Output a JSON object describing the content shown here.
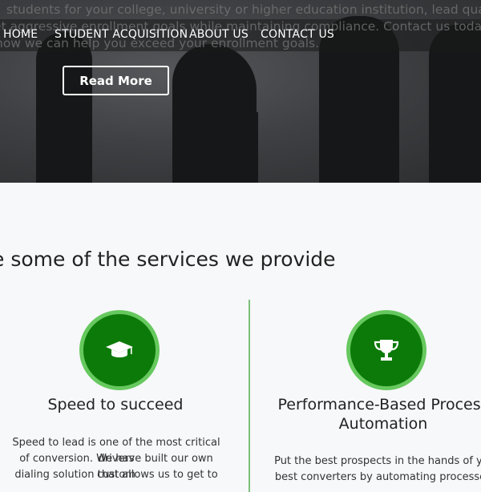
{
  "hero": {
    "text_lines": [
      "students for your college, university or higher education institution, lead quality",
      "et aggressive enrollment goals while maintaining compliance. Contact us today to",
      "how we can help you exceed your enrollment goals."
    ],
    "read_more_label": "Read More"
  },
  "nav": {
    "items": [
      {
        "label": "HOME"
      },
      {
        "label": "STUDENT ACQUISITION"
      },
      {
        "label": "ABOUT US"
      },
      {
        "label": "CONTACT US"
      }
    ]
  },
  "services": {
    "heading": "e some of the services we provide",
    "cards": [
      {
        "icon": "graduation-cap-icon",
        "title": "Speed to succeed",
        "text_lines": [
          "Speed to lead is one of the most critical drivers",
          "of conversion. We have built our own custom",
          "dialing solution that allows us to get to"
        ]
      },
      {
        "icon": "trophy-icon",
        "title_lines": [
          "Performance-Based Process",
          "Automation"
        ],
        "text_lines": [
          "Put the best prospects in the hands of you",
          "best converters by automating processes."
        ]
      }
    ]
  },
  "colors": {
    "icon_fill": "#0c7a08",
    "icon_ring": "#66c85e",
    "divider": "#7cc07a"
  }
}
